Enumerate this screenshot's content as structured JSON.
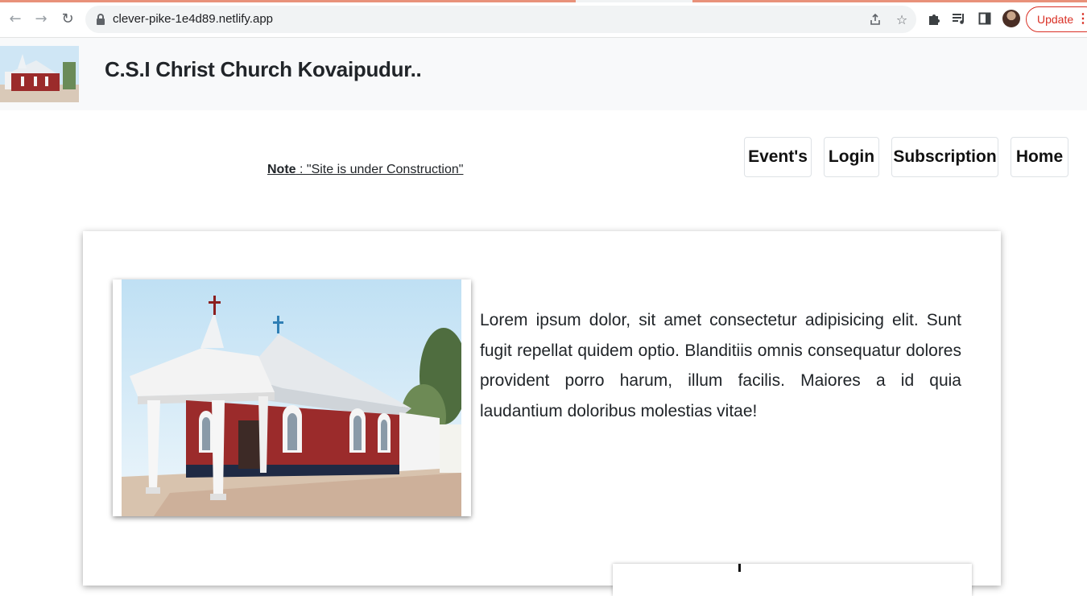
{
  "browser": {
    "url": "clever-pike-1e4d89.netlify.app",
    "update_label": "Update",
    "icons": {
      "back": "arrow-left-icon",
      "forward": "arrow-right-icon",
      "reload": "reload-icon",
      "lock": "lock-icon",
      "share": "share-icon",
      "star": "star-icon",
      "extensions": "puzzle-icon",
      "reading_list": "reading-list-icon",
      "side_panel": "side-panel-icon",
      "menu": "kebab-menu-icon"
    },
    "accent": "#d93025"
  },
  "site": {
    "title": "C.S.I Christ Church Kovaipudur..",
    "note_label": "Note",
    "note_text": " : \"Site is under Construction\"",
    "nav": [
      {
        "label": "Event's"
      },
      {
        "label": "Login"
      },
      {
        "label": "Subscription"
      },
      {
        "label": "Home"
      }
    ],
    "intro_text": "Lorem ipsum dolor, sit amet consectetur adipisicing elit. Sunt fugit repellat quidem optio. Blanditiis omnis consequatur dolores provident porro harum, illum facilis. Maiores a id quia laudantium doloribus molestias vitae!",
    "colors": {
      "header_bg": "#f8f9fa",
      "church_red": "#9b2b2b"
    }
  }
}
